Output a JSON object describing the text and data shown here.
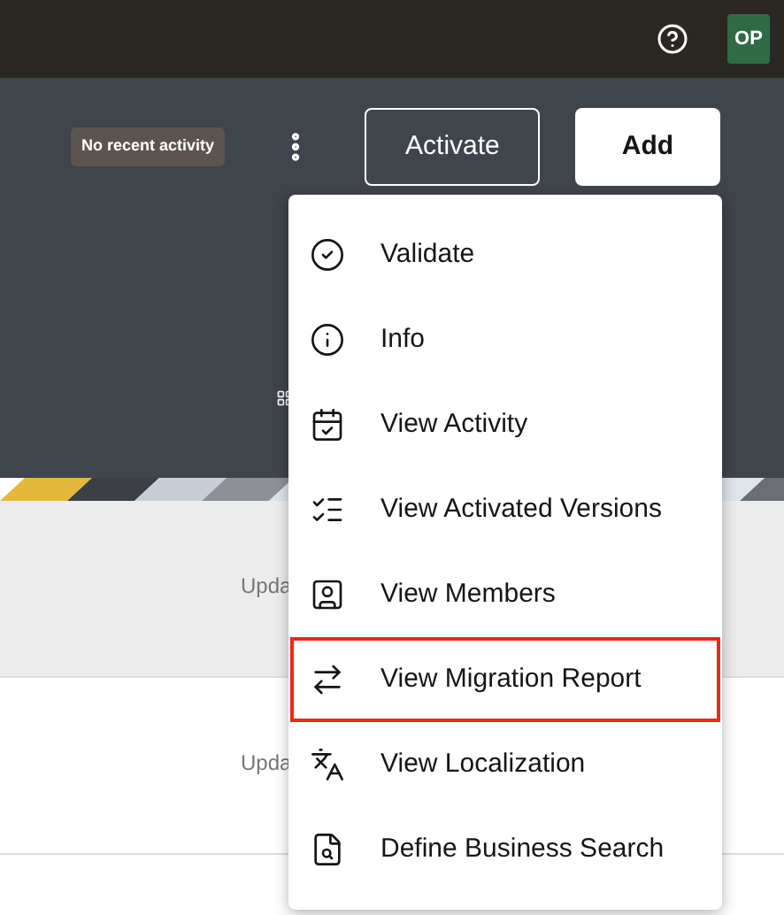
{
  "header": {
    "avatar": "OP"
  },
  "toolbar": {
    "status": "No recent activity",
    "buttons": [
      {
        "label": "Activate",
        "kind": "outline"
      },
      {
        "label": "Add",
        "kind": "solid"
      }
    ]
  },
  "rows": [
    {
      "text": "Upda"
    },
    {
      "text": "Upda"
    }
  ],
  "menu": {
    "items": [
      {
        "label": "Validate",
        "selected": false
      },
      {
        "label": "Info",
        "selected": false
      },
      {
        "label": "View Activity",
        "selected": false
      },
      {
        "label": "View Activated Versions",
        "selected": false
      },
      {
        "label": "View Members",
        "selected": false
      },
      {
        "label": "View Migration Report",
        "selected": true
      },
      {
        "label": "View Localization",
        "selected": false
      },
      {
        "label": "Define Business Search",
        "selected": false
      }
    ]
  }
}
